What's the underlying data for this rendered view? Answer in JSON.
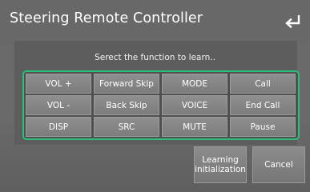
{
  "header": {
    "title": "Steering Remote Controller",
    "back_icon": "back-arrow-icon"
  },
  "main": {
    "prompt": "Serect the function to learn..",
    "accent_color": "#2cbf7a",
    "functions": [
      [
        "VOL +",
        "Forward Skip",
        "MODE",
        "Call"
      ],
      [
        "VOL -",
        "Back Skip",
        "VOICE",
        "End Call"
      ],
      [
        "DISP",
        "SRC",
        "MUTE",
        "Pause"
      ]
    ]
  },
  "actions": {
    "learning_line1": "Learning",
    "learning_line2": "initialization",
    "cancel_label": "Cancel"
  }
}
